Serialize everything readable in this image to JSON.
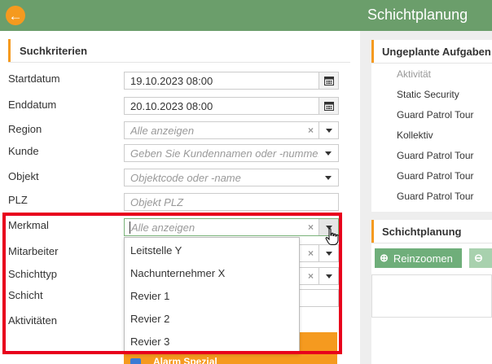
{
  "left": {
    "section_title": "Suchkriterien",
    "fields": {
      "startdatum": {
        "label": "Startdatum",
        "value": "19.10.2023 08:00"
      },
      "enddatum": {
        "label": "Enddatum",
        "value": "20.10.2023 08:00"
      },
      "region": {
        "label": "Region",
        "placeholder": "Alle anzeigen"
      },
      "kunde": {
        "label": "Kunde",
        "placeholder": "Geben Sie Kundennamen oder -nummer"
      },
      "objekt": {
        "label": "Objekt",
        "placeholder": "Objektcode oder -name"
      },
      "plz": {
        "label": "PLZ",
        "placeholder": "Objekt PLZ"
      },
      "merkmal": {
        "label": "Merkmal",
        "placeholder": "Alle anzeigen"
      },
      "mitarbeiter": {
        "label": "Mitarbeiter"
      },
      "schichttyp": {
        "label": "Schichttyp"
      },
      "schicht": {
        "label": "Schicht"
      },
      "aktivitaeten": {
        "label": "Aktivitäten"
      }
    },
    "merkmal_options": [
      "Leitstelle Y",
      "Nachunternehmer X",
      "Revier 1",
      "Revier 2",
      "Revier 3"
    ],
    "alarm_label": "Alarm Spezial"
  },
  "right": {
    "title": "Schichtplanung",
    "unplanned_title": "Ungeplante Aufgaben (",
    "tasks": [
      "Aktivität",
      "Static Security",
      "Guard Patrol Tour",
      "Kollektiv",
      "Guard Patrol Tour",
      "Guard Patrol Tour",
      "Guard Patrol Tour"
    ],
    "plan_title": "Schichtplanung",
    "zoom_in_label": "Reinzoomen"
  },
  "colors": {
    "accent": "#f59a1f",
    "header_green": "#6b9e6b",
    "highlight_red": "#e8001c",
    "button_green": "#6fae7a"
  }
}
